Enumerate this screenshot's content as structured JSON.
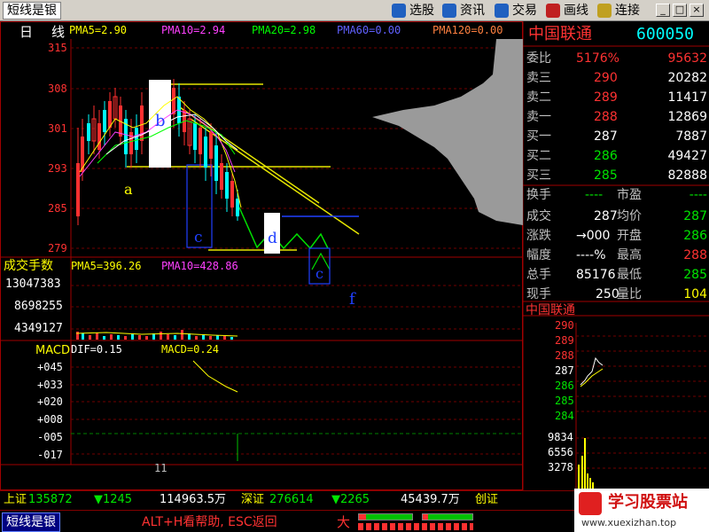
{
  "app": {
    "title": "短线是银",
    "toolbar": [
      {
        "label": "选股",
        "color": "#2060c0"
      },
      {
        "label": "资讯",
        "color": "#2060c0"
      },
      {
        "label": "交易",
        "color": "#2060c0"
      },
      {
        "label": "画线",
        "color": "#c02020"
      },
      {
        "label": "连接",
        "color": "#c0a020"
      }
    ],
    "window_buttons": [
      "_",
      "□",
      "×"
    ]
  },
  "chart": {
    "period": "日",
    "period2": "线",
    "ma": [
      {
        "label": "PMA5=2.90",
        "color": "#ffff00"
      },
      {
        "label": "PMA10=2.94",
        "color": "#ff40ff"
      },
      {
        "label": "PMA20=2.98",
        "color": "#00ff00"
      },
      {
        "label": "PMA60=0.00",
        "color": "#6060ff"
      },
      {
        "label": "PMA120=0.00",
        "color": "#ff8040"
      }
    ],
    "price_ticks": [
      "315",
      "308",
      "301",
      "293",
      "285",
      "279"
    ],
    "annotations": {
      "a": "a",
      "b": "b",
      "c1": "c",
      "d": "d",
      "c2": "c",
      "f": "f"
    },
    "volume": {
      "title": "成交手数",
      "ma5": "PMA5=396.26",
      "ma10": "PMA10=428.86",
      "ticks": [
        "13047383",
        "8698255",
        "4349127"
      ]
    },
    "macd": {
      "title": "MACD",
      "dif": "DIF=0.15",
      "macd": "MACD=0.24",
      "ticks": [
        "+045",
        "+033",
        "+020",
        "+008",
        "-005",
        "-017"
      ]
    },
    "date_label": "11"
  },
  "quote": {
    "name": "中国联通",
    "code": "600050",
    "wei_bi": {
      "label": "委比",
      "value": "5176%",
      "diff": "95632"
    },
    "asks": [
      {
        "label": "卖三",
        "price": "290",
        "vol": "20282"
      },
      {
        "label": "卖二",
        "price": "289",
        "vol": "11417"
      },
      {
        "label": "卖一",
        "price": "288",
        "vol": "12869"
      }
    ],
    "bids": [
      {
        "label": "买一",
        "price": "287",
        "vol": "7887"
      },
      {
        "label": "买二",
        "price": "286",
        "vol": "49427"
      },
      {
        "label": "买三",
        "price": "285",
        "vol": "82888"
      }
    ],
    "stats": [
      {
        "l1": "换手",
        "v1": "----",
        "l2": "市盈",
        "v2": "----"
      },
      {
        "l1": "成交",
        "v1": "287",
        "l2": "均价",
        "v2": "287"
      },
      {
        "l1": "涨跌",
        "v1": "→000",
        "l2": "开盘",
        "v2": "286"
      },
      {
        "l1": "幅度",
        "v1": "----%",
        "l2": "最高",
        "v2": "288"
      },
      {
        "l1": "总手",
        "v1": "85176",
        "l2": "最低",
        "v2": "285"
      },
      {
        "l1": "现手",
        "v1": "250",
        "l2": "量比",
        "v2": "104"
      }
    ]
  },
  "mini": {
    "name": "中国联通",
    "price_ticks": [
      "290",
      "289",
      "288",
      "287",
      "286",
      "285",
      "284"
    ],
    "vol_ticks": [
      "9834",
      "6556",
      "3278"
    ]
  },
  "status": {
    "sh_label": "上证",
    "sh_index": "135872",
    "sh_change": "▼1245",
    "sh_amount": "114963.5万",
    "sz_label": "深证",
    "sz_index": "276614",
    "sz_change": "▼2265",
    "sz_amount": "45439.7万",
    "cy_label": "创证"
  },
  "bottom": {
    "app_label": "短线是银",
    "help": "ALT+H看帮助, ESC返回",
    "big": "大"
  },
  "watermark": {
    "title": "学习股票站",
    "url": "www.xuexizhan.top"
  }
}
